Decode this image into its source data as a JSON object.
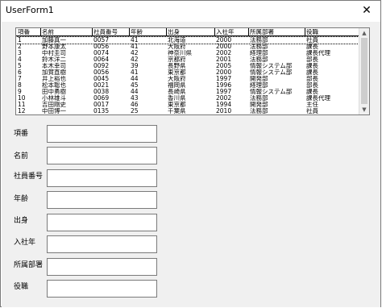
{
  "window": {
    "title": "UserForm1",
    "close_glyph": "✕"
  },
  "listbox": {
    "columns": [
      "項番",
      "名前",
      "社員番号",
      "年齢",
      "出身",
      "入社年",
      "所属部署",
      "役職"
    ],
    "rows": [
      [
        "1",
        "加藤真一",
        "0057",
        "41",
        "北海道",
        "2000",
        "法務部",
        "社員"
      ],
      [
        "2",
        "野本康太",
        "0056",
        "41",
        "大阪府",
        "2000",
        "法務部",
        "課長"
      ],
      [
        "3",
        "中村圭司",
        "0074",
        "42",
        "神奈川県",
        "2002",
        "経理部",
        "課長代理"
      ],
      [
        "4",
        "鈴木洋二",
        "0064",
        "42",
        "京都府",
        "2001",
        "法務部",
        "部長"
      ],
      [
        "5",
        "本木幸司",
        "0092",
        "39",
        "長野県",
        "2005",
        "情報システム部",
        "課長"
      ],
      [
        "6",
        "加賀直樹",
        "0056",
        "41",
        "東京都",
        "2000",
        "情報システム部",
        "課長"
      ],
      [
        "7",
        "井上裕也",
        "0045",
        "44",
        "大阪府",
        "1997",
        "開発部",
        "部長"
      ],
      [
        "8",
        "松本聡也",
        "0021",
        "45",
        "福岡県",
        "1996",
        "経理部",
        "部長"
      ],
      [
        "9",
        "田中勇樹",
        "0038",
        "44",
        "長崎県",
        "1997",
        "情報システム部",
        "課長"
      ],
      [
        "10",
        "小林雄斗",
        "0069",
        "43",
        "香川県",
        "2002",
        "法務部",
        "課長代理"
      ],
      [
        "11",
        "吉田剛史",
        "0017",
        "46",
        "東京都",
        "1994",
        "開発部",
        "主任"
      ],
      [
        "12",
        "中田博一",
        "0135",
        "25",
        "千葉県",
        "2010",
        "法務部",
        "社員"
      ]
    ]
  },
  "form": {
    "labels": [
      "項番",
      "名前",
      "社員番号",
      "年齢",
      "出身",
      "入社年",
      "所属部署",
      "役職"
    ],
    "values": [
      "",
      "",
      "",
      "",
      "",
      "",
      "",
      ""
    ]
  },
  "icons": {
    "scroll_up": "arrow-up-icon",
    "scroll_down": "arrow-down-icon",
    "close": "close-icon"
  }
}
